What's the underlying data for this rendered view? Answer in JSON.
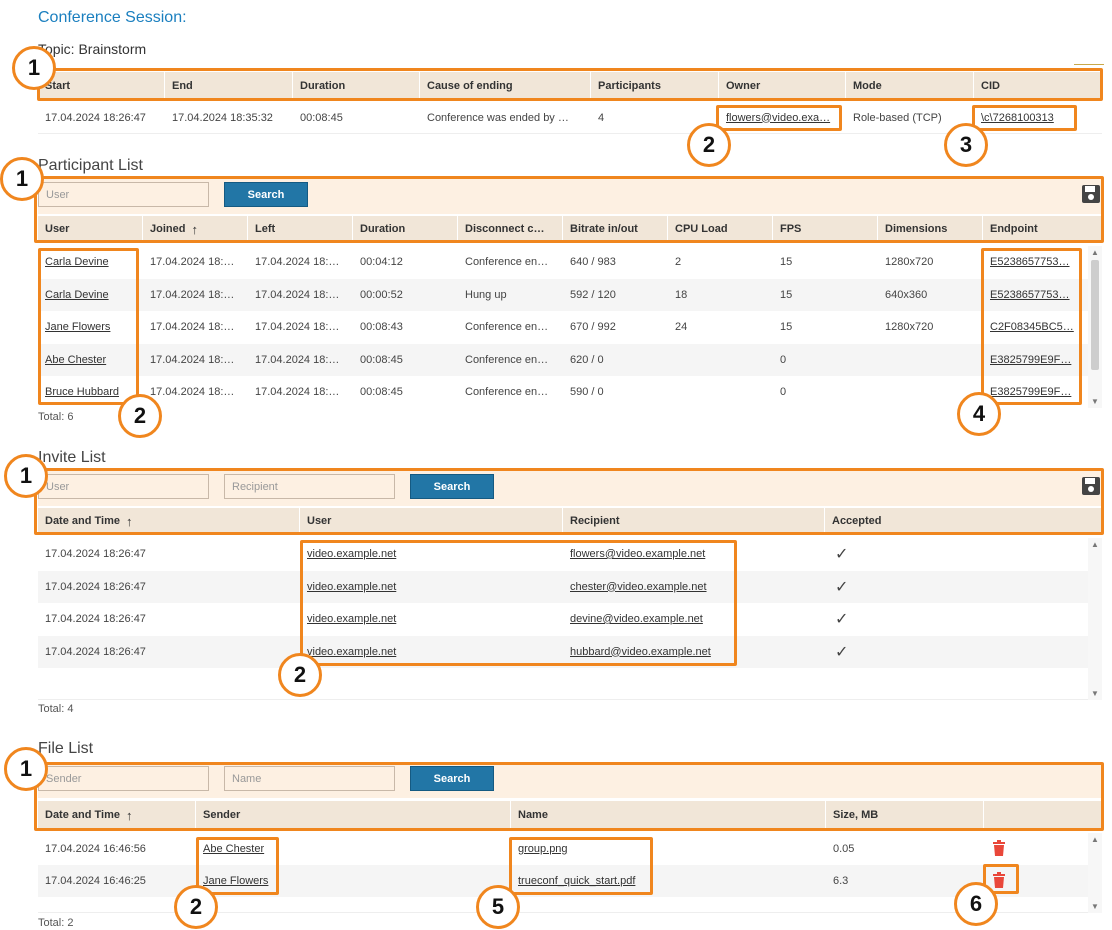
{
  "page": {
    "title": "Conference Session:",
    "topic": "Topic: Brainstorm"
  },
  "session": {
    "columns": [
      "Start",
      "End",
      "Duration",
      "Cause of ending",
      "Participants",
      "Owner",
      "Mode",
      "CID"
    ],
    "row": {
      "start": "17.04.2024 18:26:47",
      "end": "17.04.2024 18:35:32",
      "duration": "00:08:45",
      "cause": "Conference was ended by …",
      "participants": "4",
      "owner": "flowers@video.exa…",
      "mode": "Role-based (TCP)",
      "cid": "\\c\\7268100313"
    }
  },
  "participants": {
    "title": "Participant List",
    "search_placeholder": "User",
    "search_button": "Search",
    "columns": [
      "User",
      "Joined",
      "Left",
      "Duration",
      "Disconnect c…",
      "Bitrate in/out",
      "CPU Load",
      "FPS",
      "Dimensions",
      "Endpoint"
    ],
    "sorted_column_arrow": "↑",
    "rows": [
      {
        "user": "Carla Devine",
        "joined": "17.04.2024 18:…",
        "left": "17.04.2024 18:…",
        "duration": "00:04:12",
        "disconnect": "Conference en…",
        "bitrate": "640 / 983",
        "cpu": "2",
        "fps": "15",
        "dimensions": "1280x720",
        "endpoint": "E5238657753…"
      },
      {
        "user": "Carla Devine",
        "joined": "17.04.2024 18:…",
        "left": "17.04.2024 18:…",
        "duration": "00:00:52",
        "disconnect": "Hung up",
        "bitrate": "592 / 120",
        "cpu": "18",
        "fps": "15",
        "dimensions": "640x360",
        "endpoint": "E5238657753…"
      },
      {
        "user": "Jane Flowers",
        "joined": "17.04.2024 18:…",
        "left": "17.04.2024 18:…",
        "duration": "00:08:43",
        "disconnect": "Conference en…",
        "bitrate": "670 / 992",
        "cpu": "24",
        "fps": "15",
        "dimensions": "1280x720",
        "endpoint": "C2F08345BC5…"
      },
      {
        "user": "Abe Chester",
        "joined": "17.04.2024 18:…",
        "left": "17.04.2024 18:…",
        "duration": "00:08:45",
        "disconnect": "Conference en…",
        "bitrate": "620 / 0",
        "cpu": "",
        "fps": "0",
        "dimensions": "",
        "endpoint": "E3825799E9F…"
      },
      {
        "user": "Bruce Hubbard",
        "joined": "17.04.2024 18:…",
        "left": "17.04.2024 18:…",
        "duration": "00:08:45",
        "disconnect": "Conference en…",
        "bitrate": "590 / 0",
        "cpu": "",
        "fps": "0",
        "dimensions": "",
        "endpoint": "E3825799E9F…"
      }
    ],
    "total": "Total: 6"
  },
  "invites": {
    "title": "Invite List",
    "user_placeholder": "User",
    "recipient_placeholder": "Recipient",
    "search_button": "Search",
    "columns": [
      "Date and Time",
      "User",
      "Recipient",
      "Accepted"
    ],
    "sorted_column_arrow": "↑",
    "rows": [
      {
        "datetime": "17.04.2024 18:26:47",
        "user": "video.example.net",
        "recipient": "flowers@video.example.net",
        "accepted": "✓"
      },
      {
        "datetime": "17.04.2024 18:26:47",
        "user": "video.example.net",
        "recipient": "chester@video.example.net",
        "accepted": "✓"
      },
      {
        "datetime": "17.04.2024 18:26:47",
        "user": "video.example.net",
        "recipient": "devine@video.example.net",
        "accepted": "✓"
      },
      {
        "datetime": "17.04.2024 18:26:47",
        "user": "video.example.net",
        "recipient": "hubbard@video.example.net",
        "accepted": "✓"
      }
    ],
    "total": "Total: 4"
  },
  "files": {
    "title": "File List",
    "sender_placeholder": "Sender",
    "name_placeholder": "Name",
    "search_button": "Search",
    "columns": [
      "Date and Time",
      "Sender",
      "Name",
      "Size, MB",
      ""
    ],
    "sorted_column_arrow": "↑",
    "rows": [
      {
        "datetime": "17.04.2024 16:46:56",
        "sender": "Abe Chester",
        "name": "group.png",
        "size": "0.05"
      },
      {
        "datetime": "17.04.2024 16:46:25",
        "sender": "Jane Flowers",
        "name": "trueconf_quick_start.pdf",
        "size": "6.3"
      }
    ],
    "total": "Total: 2"
  },
  "badges": [
    "1",
    "2",
    "3",
    "4",
    "5",
    "6"
  ],
  "icons": {
    "save": "save-icon",
    "delete": "trash-icon",
    "check": "check-icon"
  },
  "colors": {
    "accent": "#f0861e",
    "button": "#2276a6",
    "header": "#f1e6d8",
    "toolbar": "#fdf0e2",
    "title": "#1a7fbf",
    "delete": "#e9473a"
  }
}
